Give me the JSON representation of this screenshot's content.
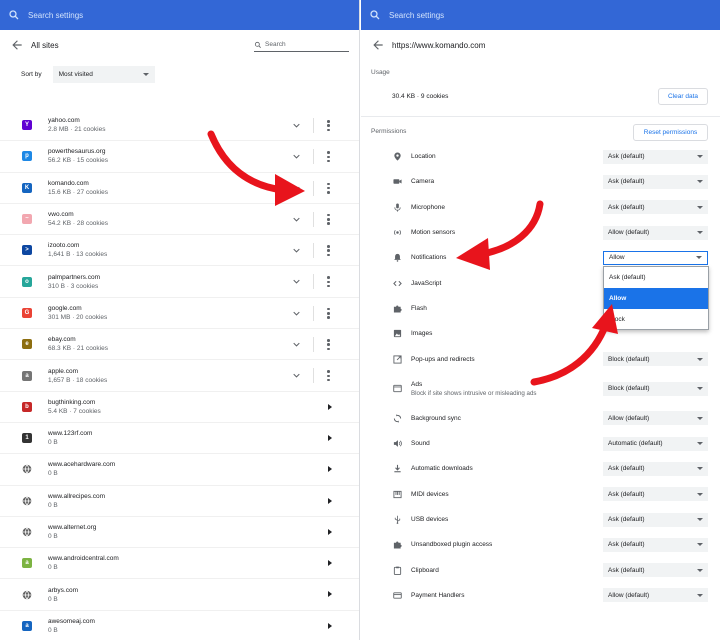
{
  "search_placeholder": "Search settings",
  "left": {
    "title": "All sites",
    "search_placeholder": "Search",
    "sort_label": "Sort by",
    "sort_value": "Most visited",
    "sites": [
      {
        "name": "yahoo.com",
        "info": "2.8 MB · 21 cookies",
        "icon": "yahoo-icon",
        "color": "#6001d2",
        "glyph": "Y",
        "expand": true
      },
      {
        "name": "powerthesaurus.org",
        "info": "56.2 KB · 15 cookies",
        "icon": "powerthesaurus-icon",
        "color": "#1e88e5",
        "glyph": "p",
        "expand": true
      },
      {
        "name": "komando.com",
        "info": "15.6 KB · 27 cookies",
        "icon": "komando-icon",
        "color": "#1565c0",
        "glyph": "K",
        "expand": true
      },
      {
        "name": "vwo.com",
        "info": "54.2 KB · 28 cookies",
        "icon": "vwo-icon",
        "color": "#f2a7b0",
        "glyph": "~",
        "expand": true
      },
      {
        "name": "izooto.com",
        "info": "1,641 B · 13 cookies",
        "icon": "izooto-icon",
        "color": "#0d47a1",
        "glyph": ">",
        "expand": true
      },
      {
        "name": "palmpartners.com",
        "info": "310 B · 3 cookies",
        "icon": "palmpartners-icon",
        "color": "#26a69a",
        "glyph": "o",
        "expand": true
      },
      {
        "name": "google.com",
        "info": "301 MB · 20 cookies",
        "icon": "google-icon",
        "color": "#ea4335",
        "glyph": "G",
        "expand": true
      },
      {
        "name": "ebay.com",
        "info": "68.3 KB · 21 cookies",
        "icon": "ebay-icon",
        "color": "#8d6e0f",
        "glyph": "e",
        "expand": true
      },
      {
        "name": "apple.com",
        "info": "1,657 B · 18 cookies",
        "icon": "apple-icon",
        "color": "#757575",
        "glyph": "a",
        "expand": true
      },
      {
        "name": "bugthinking.com",
        "info": "5.4 KB · 7 cookies",
        "icon": "bugthinking-icon",
        "color": "#c62828",
        "glyph": "b",
        "expand": false
      },
      {
        "name": "www.123rf.com",
        "info": "0 B",
        "icon": "123rf-icon",
        "color": "#333333",
        "glyph": "1",
        "expand": false
      },
      {
        "name": "www.acehardware.com",
        "info": "0 B",
        "icon": "globe-icon",
        "color": "#616161",
        "glyph": "",
        "expand": false
      },
      {
        "name": "www.allrecipes.com",
        "info": "0 B",
        "icon": "globe-icon",
        "color": "#616161",
        "glyph": "",
        "expand": false
      },
      {
        "name": "www.alternet.org",
        "info": "0 B",
        "icon": "globe-icon",
        "color": "#616161",
        "glyph": "",
        "expand": false
      },
      {
        "name": "www.androidcentral.com",
        "info": "0 B",
        "icon": "androidcentral-icon",
        "color": "#7cb342",
        "glyph": "a",
        "expand": false
      },
      {
        "name": "arbys.com",
        "info": "0 B",
        "icon": "globe-icon",
        "color": "#616161",
        "glyph": "",
        "expand": false
      },
      {
        "name": "awesomeaj.com",
        "info": "0 B",
        "icon": "awesomeaj-icon",
        "color": "#1565c0",
        "glyph": "a",
        "expand": false
      }
    ]
  },
  "right": {
    "title": "https://www.komando.com",
    "usage_header": "Usage",
    "usage_value": "30.4 KB · 9 cookies",
    "clear_label": "Clear data",
    "permissions_header": "Permissions",
    "reset_label": "Reset permissions",
    "permissions": [
      {
        "label": "Location",
        "value": "Ask (default)",
        "icon": "location-icon"
      },
      {
        "label": "Camera",
        "value": "Ask (default)",
        "icon": "camera-icon"
      },
      {
        "label": "Microphone",
        "value": "Ask (default)",
        "icon": "microphone-icon"
      },
      {
        "label": "Motion sensors",
        "value": "Allow (default)",
        "icon": "motion-sensors-icon"
      },
      {
        "label": "Notifications",
        "value": "Allow",
        "icon": "bell-icon"
      },
      {
        "label": "JavaScript",
        "value": "",
        "icon": "code-icon"
      },
      {
        "label": "Flash",
        "value": "",
        "icon": "puzzle-icon"
      },
      {
        "label": "Images",
        "value": "",
        "icon": "image-icon"
      },
      {
        "label": "Pop-ups and redirects",
        "value": "Block (default)",
        "icon": "popup-icon"
      },
      {
        "label": "Ads",
        "sub": "Block if site shows intrusive or misleading ads",
        "value": "Block (default)",
        "icon": "ads-icon"
      },
      {
        "label": "Background sync",
        "value": "Allow (default)",
        "icon": "sync-icon"
      },
      {
        "label": "Sound",
        "value": "Automatic (default)",
        "icon": "sound-icon"
      },
      {
        "label": "Automatic downloads",
        "value": "Ask (default)",
        "icon": "download-icon"
      },
      {
        "label": "MIDI devices",
        "value": "Ask (default)",
        "icon": "midi-icon"
      },
      {
        "label": "USB devices",
        "value": "Ask (default)",
        "icon": "usb-icon"
      },
      {
        "label": "Unsandboxed plugin access",
        "value": "Ask (default)",
        "icon": "plugin-icon"
      },
      {
        "label": "Clipboard",
        "value": "Ask (default)",
        "icon": "clipboard-icon"
      },
      {
        "label": "Payment Handlers",
        "value": "Allow (default)",
        "icon": "payment-icon"
      }
    ],
    "dropdown_options": [
      "Ask (default)",
      "Allow",
      "Block"
    ],
    "dropdown_selected": "Allow"
  },
  "annotation_color": "#e8141c"
}
